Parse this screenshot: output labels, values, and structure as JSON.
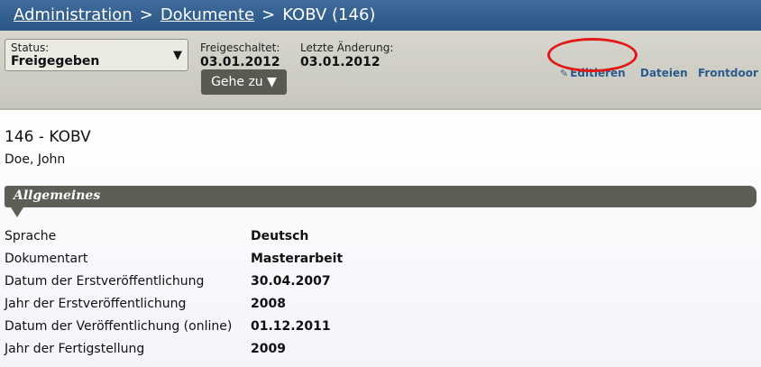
{
  "breadcrumb": {
    "admin": "Administration",
    "sep1": ">",
    "docs": "Dokumente",
    "sep2": ">",
    "current": "KOBV (146)"
  },
  "toolbar": {
    "status_label": "Status:",
    "status_value": "Freigegeben",
    "freigeschaltet_label": "Freigeschaltet:",
    "freigeschaltet_value": "03.01.2012",
    "aenderung_label": "Letzte Änderung:",
    "aenderung_value": "03.01.2012",
    "goto_label": "Gehe zu",
    "actions": {
      "edit": "Editieren",
      "files": "Dateien",
      "frontdoor": "Frontdoor"
    }
  },
  "document": {
    "title": "146 - KOBV",
    "author": "Doe, John"
  },
  "section": {
    "title": "Allgemeines"
  },
  "properties": [
    {
      "key": "Sprache",
      "value": "Deutsch"
    },
    {
      "key": "Dokumentart",
      "value": "Masterarbeit"
    },
    {
      "key": "Datum der Erstveröffentlichung",
      "value": "30.04.2007"
    },
    {
      "key": "Jahr der Erstveröffentlichung",
      "value": "2008"
    },
    {
      "key": "Datum der Veröffentlichung (online)",
      "value": "01.12.2011"
    },
    {
      "key": "Jahr der Fertigstellung",
      "value": "2009"
    }
  ],
  "colors": {
    "titlebar": "#2f5d8f",
    "toolbar": "#d0cfc6",
    "link": "#2b5b8c",
    "highlight": "#e01818",
    "section": "#5e5e56"
  }
}
